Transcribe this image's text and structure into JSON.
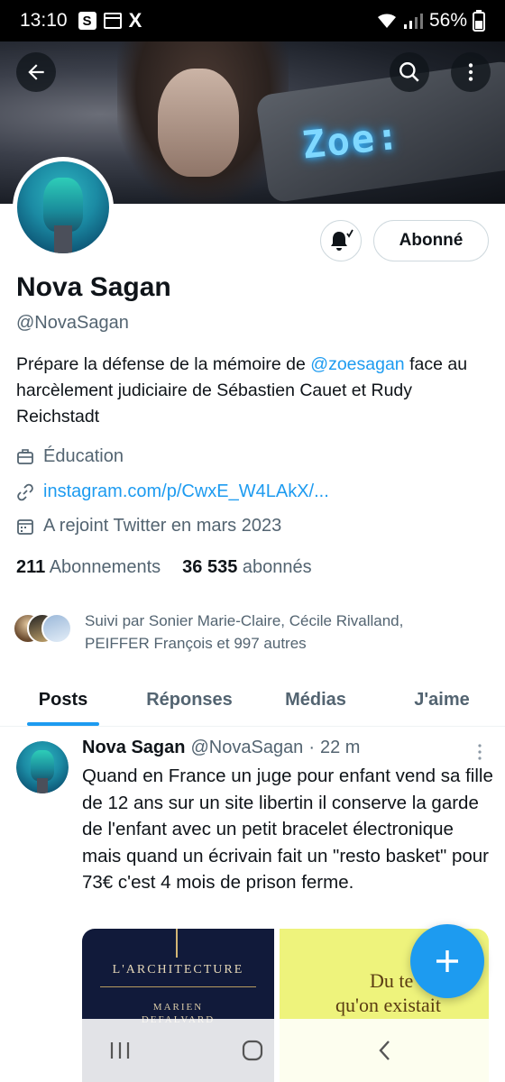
{
  "status_bar": {
    "time": "13:10",
    "s_badge": "S",
    "x_app": "X",
    "battery": "56%"
  },
  "banner": {
    "neon_text": "Zoe:"
  },
  "profile": {
    "name": "Nova Sagan",
    "handle": "@NovaSagan",
    "follow_button": "Abonné",
    "bio_part1": "Prépare la défense de la mémoire de ",
    "bio_mention": "@zoesagan",
    "bio_part2": " face au harcèlement judiciaire de Sébastien Cauet et Rudy Reichstadt",
    "category": "Éducation",
    "link": "instagram.com/p/CwxE_W4LAkX/...",
    "joined": "A rejoint Twitter en mars 2023",
    "following_count": "211",
    "following_label": "Abonnements",
    "followers_count": "36 535",
    "followers_label": "abonnés",
    "followed_by_line1": "Suivi par Sonier Marie-Claire, Cécile Rivalland,",
    "followed_by_line2": "PEIFFER François et 997 autres"
  },
  "tabs": [
    {
      "label": "Posts",
      "active": true
    },
    {
      "label": "Réponses",
      "active": false
    },
    {
      "label": "Médias",
      "active": false
    },
    {
      "label": "J'aime",
      "active": false
    }
  ],
  "tweet": {
    "name": "Nova Sagan",
    "handle": "@NovaSagan",
    "separator": "·",
    "time": "22 m",
    "text": "Quand en France un juge pour enfant vend sa fille de 12 ans sur un site libertin il conserve la garde de l'enfant avec un petit bracelet électronique mais quand un écrivain fait un \"resto basket\" pour 73€ c'est 4 mois de prison ferme.",
    "media": [
      {
        "title": "L'ARCHITECTURE",
        "author_line1": "MARIEN",
        "author_line2": "DEFALVARD"
      },
      {
        "line1": "Du te",
        "line2": "qu'on existait"
      }
    ]
  },
  "colors": {
    "accent": "#1d9bf0",
    "text_primary": "#0f1419",
    "text_secondary": "#536471"
  },
  "icons": {
    "back": "arrow-left-icon",
    "search": "search-icon",
    "more": "more-vertical-icon",
    "notifications": "bell-icon",
    "category": "briefcase-icon",
    "link": "link-icon",
    "joined": "calendar-icon",
    "compose": "plus-icon"
  }
}
